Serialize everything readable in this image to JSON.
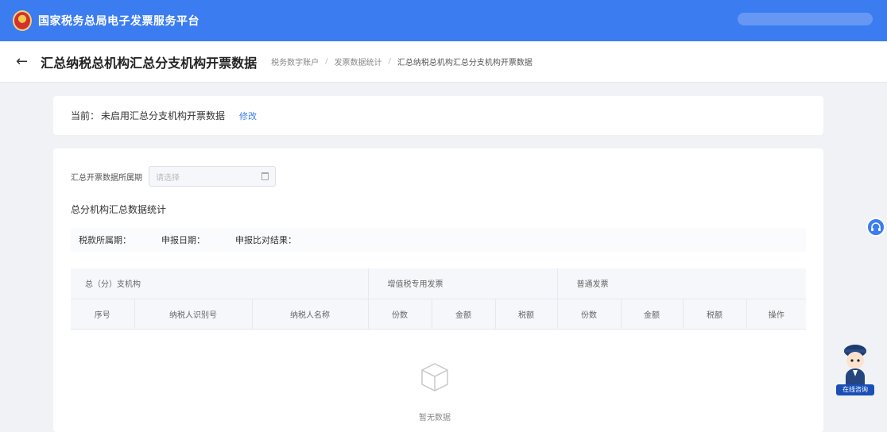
{
  "header": {
    "site_title": "国家税务总局电子发票服务平台"
  },
  "subheader": {
    "back_icon": "arrow-left-icon",
    "page_title": "汇总纳税总机构汇总分支机构开票数据",
    "breadcrumbs": [
      "税务数字账户",
      "发票数据统计",
      "汇总纳税总机构汇总分支机构开票数据"
    ]
  },
  "status_card": {
    "label": "当前：",
    "value": "未启用汇总分支机构开票数据",
    "modify_link": "修改"
  },
  "filter": {
    "label": "汇总开票数据所属期",
    "placeholder": "请选择",
    "icon": "calendar-icon"
  },
  "section_title": "总分机构汇总数据统计",
  "info_row": {
    "tax_period": "税款所属期：",
    "declare_date": "申报日期：",
    "compare_result": "申报比对结果："
  },
  "table": {
    "group_headers": [
      "总（分）支机构",
      "增值税专用发票",
      "普通发票"
    ],
    "columns": [
      "序号",
      "纳税人识别号",
      "纳税人名称",
      "份数",
      "金额",
      "税额",
      "份数",
      "金额",
      "税额",
      "操作"
    ]
  },
  "empty_state": {
    "icon": "empty-box-icon",
    "text": "暂无数据"
  },
  "floating": {
    "support_icon": "headset-icon",
    "assistant_label": "在线咨询"
  },
  "colors": {
    "brand_blue": "#3b7cf0",
    "page_bg": "#f0f2f5"
  }
}
